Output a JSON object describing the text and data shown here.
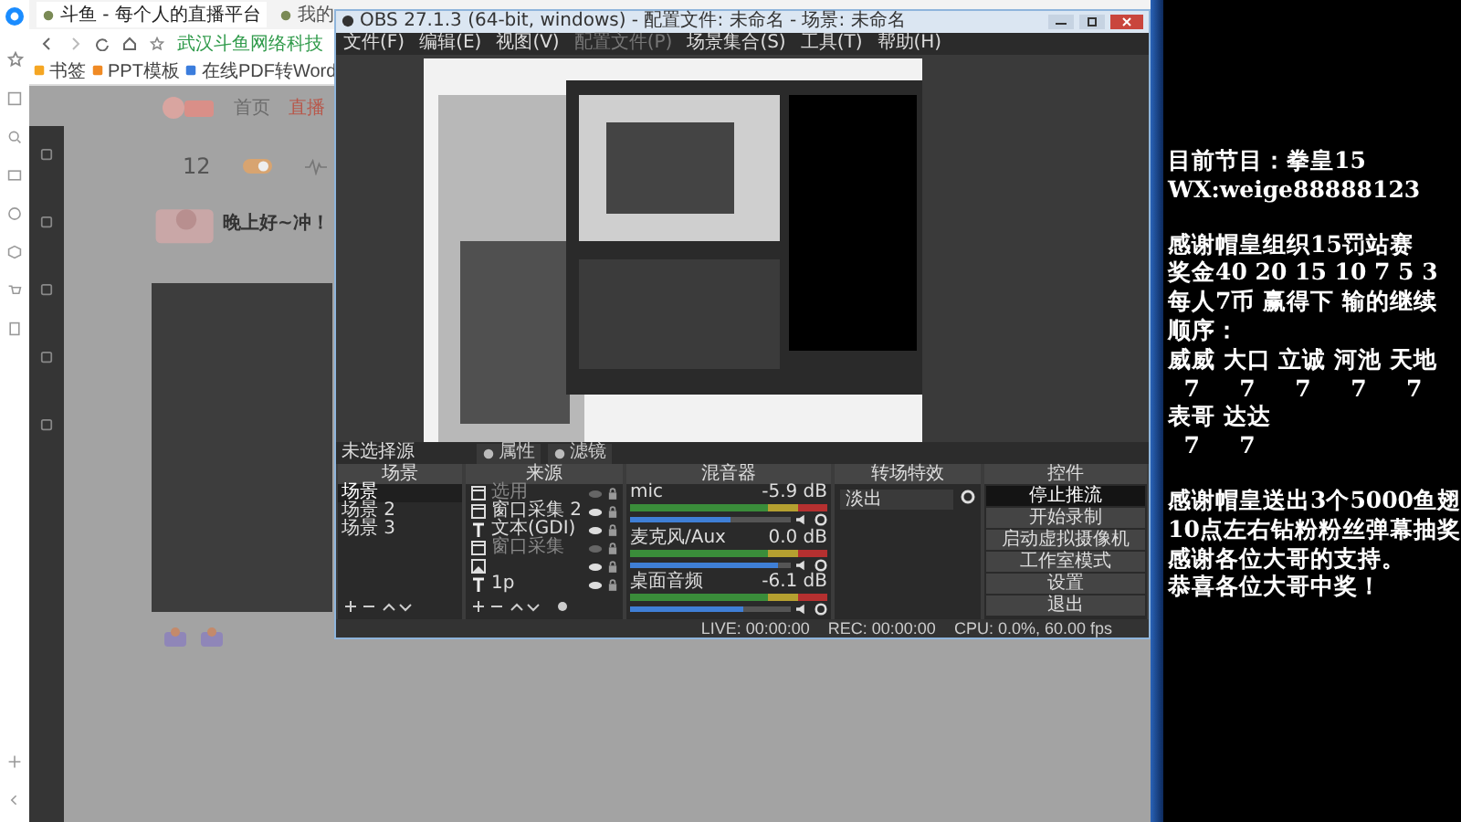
{
  "browser": {
    "tabs": [
      {
        "title": "斗鱼 - 每个人的直播平台",
        "selected": true
      },
      {
        "title": "我的",
        "selected": false
      }
    ],
    "address": "武汉斗鱼网络科技",
    "bookmarks": [
      "书签",
      "PPT模板",
      "在线PDF转Word"
    ],
    "page": {
      "nav": [
        {
          "label": "首页",
          "selected": false
        },
        {
          "label": "直播",
          "selected": true
        }
      ],
      "count": "12",
      "greeting": "晚上好~冲！"
    }
  },
  "obs": {
    "title": "OBS 27.1.3 (64-bit, windows) - 配置文件: 未命名 - 场景: 未命名",
    "menu": [
      {
        "label": "文件(F)",
        "disabled": false
      },
      {
        "label": "编辑(E)",
        "disabled": false
      },
      {
        "label": "视图(V)",
        "disabled": false
      },
      {
        "label": "配置文件(P)",
        "disabled": true
      },
      {
        "label": "场景集合(S)",
        "disabled": false
      },
      {
        "label": "工具(T)",
        "disabled": false
      },
      {
        "label": "帮助(H)",
        "disabled": false
      }
    ],
    "source_bar": {
      "label": "未选择源",
      "buttons": [
        "属性",
        "滤镜"
      ]
    },
    "docks": [
      "场景",
      "来源",
      "混音器",
      "转场特效",
      "控件"
    ],
    "scenes": [
      {
        "name": "场景",
        "selected": true
      },
      {
        "name": "场景 2",
        "selected": false
      },
      {
        "name": "场景 3",
        "selected": false
      }
    ],
    "sources": [
      {
        "name": "选用",
        "kind": "window",
        "visible": false
      },
      {
        "name": "窗口采集 2",
        "kind": "window",
        "visible": true
      },
      {
        "name": "文本(GDI)",
        "kind": "text",
        "visible": true
      },
      {
        "name": "窗口采集",
        "kind": "window",
        "visible": false
      },
      {
        "kind": "image",
        "visible": true
      },
      {
        "name": "1p",
        "kind": "text",
        "visible": true
      }
    ],
    "mixer": [
      {
        "name": "mic",
        "reading": "-5.9 dB",
        "level": 0.62
      },
      {
        "name": "麦克风/Aux",
        "reading": "0.0 dB",
        "level": 0.92
      },
      {
        "name": "桌面音频",
        "reading": "-6.1 dB",
        "level": 0.7
      }
    ],
    "transition": "淡出",
    "controls": [
      {
        "label": "停止推流",
        "active": true
      },
      {
        "label": "开始录制",
        "active": false
      },
      {
        "label": "启动虚拟摄像机",
        "active": false
      },
      {
        "label": "工作室模式",
        "active": false
      },
      {
        "label": "设置",
        "active": false
      },
      {
        "label": "退出",
        "active": false
      }
    ],
    "status": {
      "live": "LIVE: 00:00:00",
      "rec": "REC: 00:00:00",
      "cpu": "CPU: 0.0%, 60.00 fps"
    }
  },
  "overlay_text": [
    [
      "目前节目：拳皇15",
      "WX:weige88888123"
    ],
    [
      "感谢帽皇组织15罚站赛",
      "奖金40 20 15 10 7 5 3",
      "每人7币 赢得下 输的继续",
      "顺序：",
      "威威 大口 立诚 河池 天地",
      "  7     7     7     7     7",
      "表哥 达达",
      "  7     7"
    ],
    [
      "感谢帽皇送出3个5000鱼翅",
      "10点左右钻粉粉丝弹幕抽奖",
      "感谢各位大哥的支持。",
      "恭喜各位大哥中奖！"
    ]
  ]
}
